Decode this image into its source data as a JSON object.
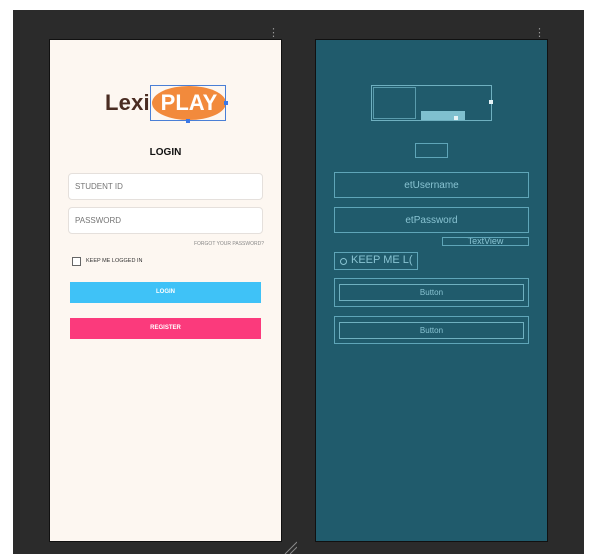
{
  "design": {
    "logo": {
      "text_left": "Lexi",
      "text_badge": "PLAY"
    },
    "title": "LOGIN",
    "student_id_placeholder": "STUDENT ID",
    "password_placeholder": "PASSWORD",
    "forgot_password": "FORGOT YOUR PASSWORD?",
    "keep_logged_in": "KEEP ME LOGGED IN",
    "login_button": "LOGIN",
    "register_button": "REGISTER"
  },
  "blueprint": {
    "username_id": "etUsername",
    "password_id": "etPassword",
    "textview_label": "TextView",
    "checkbox_label": "KEEP ME L(",
    "button1_label": "Button",
    "button2_label": "Button"
  },
  "colors": {
    "canvas_bg": "#2b2b2b",
    "phone_bg": "#fdf7f1",
    "brand_brown": "#4a2c22",
    "brand_orange": "#f28a3c",
    "login_blue": "#3fc2f7",
    "register_pink": "#fb3a7c",
    "blueprint_bg": "#205b6c",
    "selection_blue": "#3b78e7"
  },
  "icons": [
    "overflow-menu-icon",
    "resize-grip-icon"
  ]
}
